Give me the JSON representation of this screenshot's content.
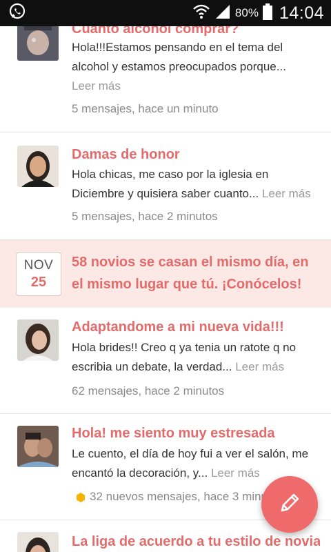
{
  "status_bar": {
    "battery_percent": "80%",
    "time": "14:04",
    "icons": [
      "whatsapp-icon",
      "wifi-icon",
      "signal-icon",
      "battery-icon"
    ]
  },
  "colors": {
    "accent": "#e36b6b",
    "promo_bg": "#fce9e5",
    "fab": "#ef6a6a",
    "new_badge": "#f4b400"
  },
  "posts": [
    {
      "title": "Cuanto alcohol comprar?",
      "body": "Hola!!!Estamos pensando en el tema del alcohol y estamos preocupados porque...",
      "more": "Leer más",
      "meta": "5 mensajes, hace un minuto"
    },
    {
      "title": "Damas de honor",
      "body": "Hola chicas, me caso por la iglesia en Diciembre y quisiera saber cuanto...",
      "more": "Leer más",
      "meta": "5 mensajes, hace 2 minutos"
    },
    {
      "title": "Adaptandome a mi nueva vida!!!",
      "body": "Hola brides!! Creo q ya tenia un ratote q no escribia un debate, la verdad...",
      "more": "Leer más",
      "meta": "62 mensajes, hace 2 minutos"
    },
    {
      "title": "Hola! me siento muy estresada",
      "body": "Le cuento, el día de hoy fui a ver el salón, me encantó la decoración, y...",
      "more": "Leer más",
      "meta": "32 nuevos mensajes, hace 3 minutos"
    },
    {
      "title": "La liga de acuerdo a tu estilo de novia"
    }
  ],
  "promo": {
    "month": "NOV",
    "day": "25",
    "text": "58 novios se casan el mismo día, en el mismo lugar que tú. ¡Conócelos!"
  },
  "fab": {
    "icon": "pencil-icon"
  }
}
